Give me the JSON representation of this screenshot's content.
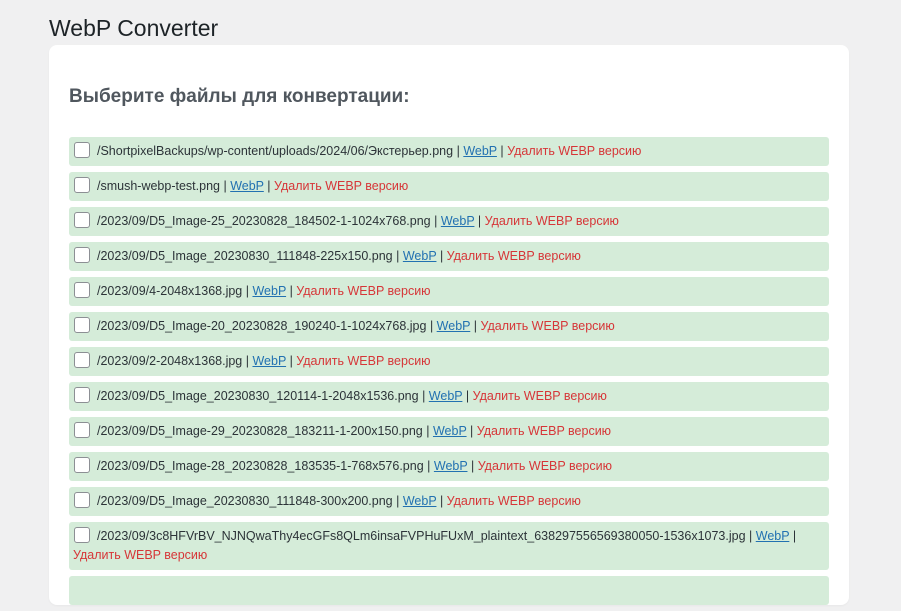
{
  "page": {
    "title": "WebP Converter"
  },
  "section": {
    "heading": "Выберите файлы для конвертации:"
  },
  "separator": "|",
  "files": [
    {
      "path": "/ShortpixelBackups/wp-content/uploads/2024/06/Экстерьер.png",
      "webp_label": "WebP",
      "delete_label": "Удалить WEBP версию"
    },
    {
      "path": "/smush-webp-test.png",
      "webp_label": "WebP",
      "delete_label": "Удалить WEBP версию"
    },
    {
      "path": "/2023/09/D5_Image-25_20230828_184502-1-1024x768.png",
      "webp_label": "WebP",
      "delete_label": "Удалить WEBP версию"
    },
    {
      "path": "/2023/09/D5_Image_20230830_111848-225x150.png",
      "webp_label": "WebP",
      "delete_label": "Удалить WEBP версию"
    },
    {
      "path": "/2023/09/4-2048x1368.jpg",
      "webp_label": "WebP",
      "delete_label": "Удалить WEBP версию"
    },
    {
      "path": "/2023/09/D5_Image-20_20230828_190240-1-1024x768.jpg",
      "webp_label": "WebP",
      "delete_label": "Удалить WEBP версию"
    },
    {
      "path": "/2023/09/2-2048x1368.jpg",
      "webp_label": "WebP",
      "delete_label": "Удалить WEBP версию"
    },
    {
      "path": "/2023/09/D5_Image_20230830_120114-1-2048x1536.png",
      "webp_label": "WebP",
      "delete_label": "Удалить WEBP версию"
    },
    {
      "path": "/2023/09/D5_Image-29_20230828_183211-1-200x150.png",
      "webp_label": "WebP",
      "delete_label": "Удалить WEBP версию"
    },
    {
      "path": "/2023/09/D5_Image-28_20230828_183535-1-768x576.png",
      "webp_label": "WebP",
      "delete_label": "Удалить WEBP версию"
    },
    {
      "path": "/2023/09/D5_Image_20230830_111848-300x200.png",
      "webp_label": "WebP",
      "delete_label": "Удалить WEBP версию"
    },
    {
      "path": "/2023/09/3c8HFVrBV_NJNQwaThy4ecGFs8QLm6insaFVPHuFUxM_plaintext_638297556569380050-1536x1073.jpg",
      "webp_label": "WebP",
      "delete_label": "Удалить WEBP версию"
    }
  ]
}
